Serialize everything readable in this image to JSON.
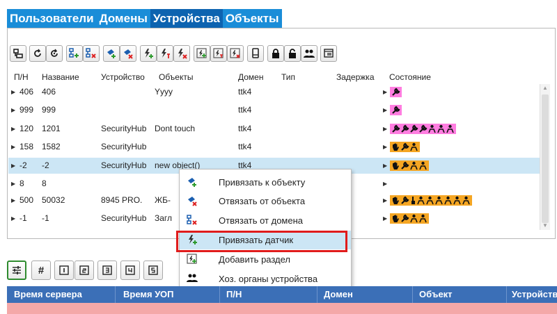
{
  "tabs": [
    "Пользователи",
    "Домены",
    "Устройства",
    "Объекты"
  ],
  "active_tab": 2,
  "columns": {
    "pn": "П/Н",
    "name": "Название",
    "device": "Устройство",
    "objects": "Объекты",
    "domain": "Домен",
    "type": "Тип",
    "delay": "Задержка",
    "state": "Состояние"
  },
  "rows": [
    {
      "pn": "406",
      "name": "406",
      "device": "",
      "objects": "Yyyy",
      "domain": "ttk4",
      "state": "k"
    },
    {
      "pn": "999",
      "name": "999",
      "device": "",
      "objects": "",
      "domain": "ttk4",
      "state": "k"
    },
    {
      "pn": "120",
      "name": "1201",
      "device": "SecurityHub",
      "objects": "Dont touch",
      "domain": "ttk4",
      "state": "kkkkppp"
    },
    {
      "pn": "158",
      "name": "1582",
      "device": "SecurityHub",
      "objects": "",
      "domain": "ttk4",
      "state": "hkp"
    },
    {
      "pn": "-2",
      "name": "-2",
      "device": "SecurityHub",
      "objects": "new object()",
      "domain": "ttk4",
      "state": "hkpp"
    },
    {
      "pn": "8",
      "name": "8",
      "device": "",
      "objects": "",
      "domain": "",
      "state": ""
    },
    {
      "pn": "500",
      "name": "50032",
      "device": "8945 PRO.",
      "objects": "ЖБ-",
      "domain": "",
      "state": "hkipppppp"
    },
    {
      "pn": "-1",
      "name": "-1",
      "device": "SecurityHub",
      "objects": "Загл",
      "domain": "",
      "state": "hkpp"
    }
  ],
  "selected_row": 4,
  "context_menu": [
    {
      "label": "Привязать к объекту",
      "icon": "bind-object-icon"
    },
    {
      "label": "Отвязать от объекта",
      "icon": "unbind-object-icon"
    },
    {
      "label": "Отвязать от домена",
      "icon": "unbind-domain-icon"
    },
    {
      "label": "Привязать датчик",
      "icon": "bind-sensor-icon"
    },
    {
      "label": "Добавить раздел",
      "icon": "add-section-icon"
    },
    {
      "label": "Хоз. органы устройства",
      "icon": "device-managers-icon"
    }
  ],
  "highlighted_menu_item": 3,
  "bottom_toolbar": {
    "hash_label": "#"
  },
  "grid_columns": [
    "Время сервера",
    "Время УОП",
    "П/Н",
    "Домен",
    "Объект",
    "Устройство"
  ],
  "colors": {
    "tab_bar": "#1a8dd8",
    "tab_active": "#0d63b0",
    "state_pink": "#ff7de0",
    "state_orange": "#f5a623",
    "selection": "#cce6f5",
    "grid_header": "#3b6fb7",
    "highlight_border": "#e01c1c"
  }
}
